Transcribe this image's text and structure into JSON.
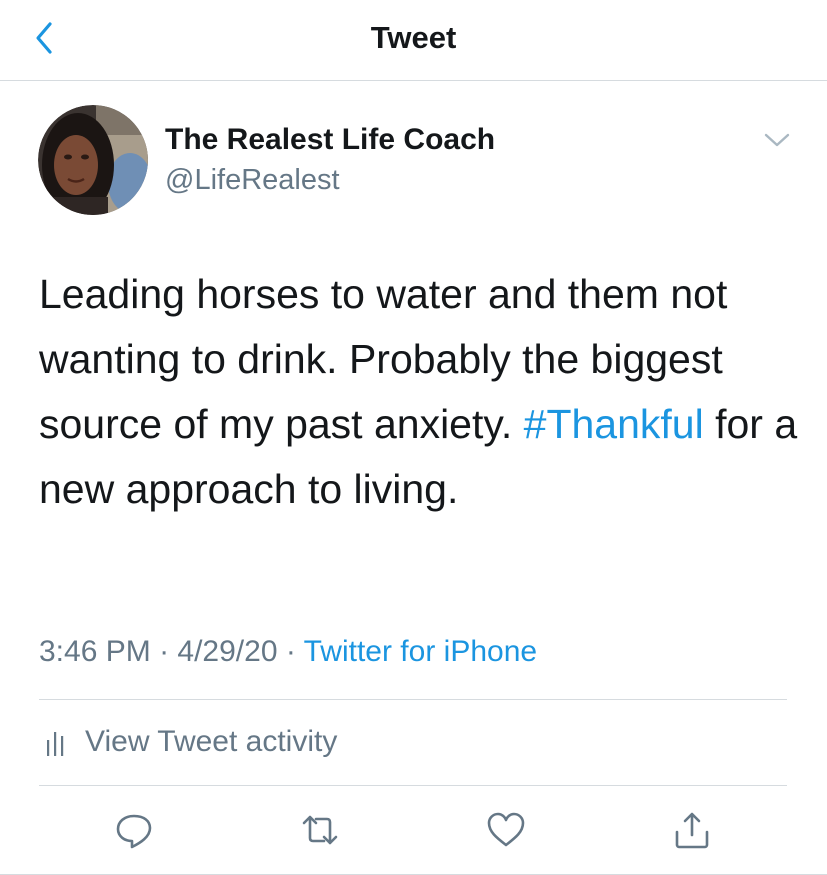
{
  "nav": {
    "title": "Tweet",
    "back_icon": "chevron-left-icon"
  },
  "tweet": {
    "author": {
      "display_name": "The Realest Life Coach",
      "handle": "@LifeRealest"
    },
    "text_before_hashtag": "Leading horses to water and them not wanting to drink. Probably the biggest source of my past anxiety.",
    "hashtag": "#Thankful",
    "text_after_hashtag": " for a new approach to living.",
    "time": "3:46 PM",
    "separator": " · ",
    "date": "4/29/20",
    "source": "Twitter for iPhone"
  },
  "activity": {
    "label": "View Tweet activity",
    "icon": "bar-chart-icon"
  },
  "actions": {
    "reply_icon": "reply-icon",
    "retweet_icon": "retweet-icon",
    "like_icon": "like-icon",
    "share_icon": "share-icon"
  },
  "colors": {
    "accent": "#1b95e0",
    "text": "#14171a",
    "secondary": "#657786",
    "divider": "#d6dbdf",
    "icon": "#657786"
  }
}
